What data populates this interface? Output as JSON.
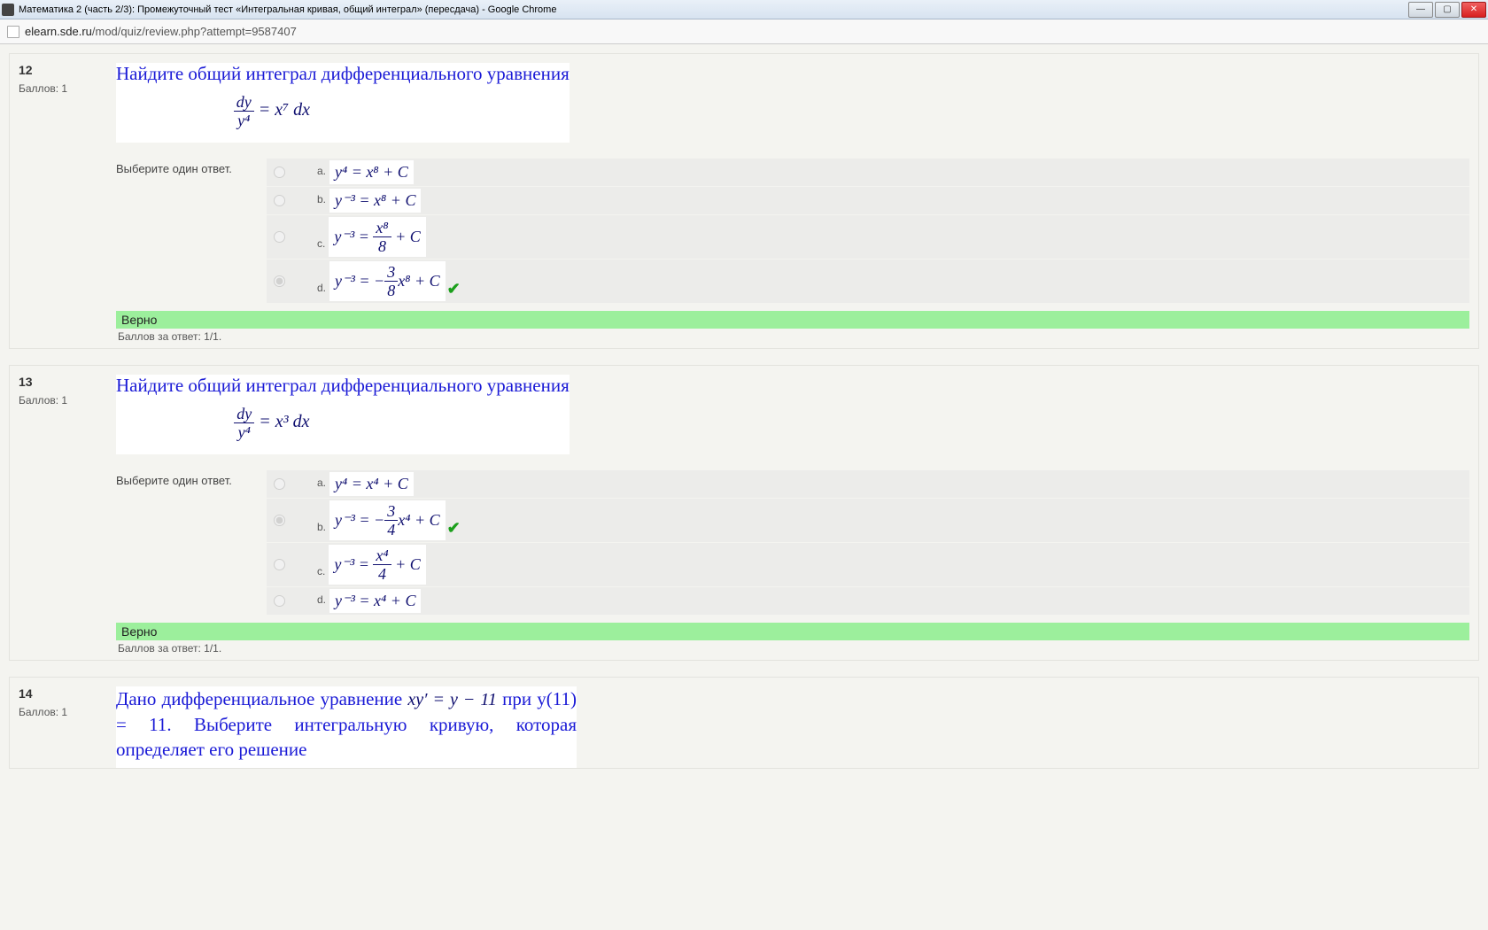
{
  "window": {
    "title": "Математика 2 (часть 2/3): Промежуточный тест «Интегральная кривая, общий интеграл» (пересдача) - Google Chrome",
    "url_domain": "elearn.sde.ru",
    "url_path": "/mod/quiz/review.php?attempt=9587407"
  },
  "common": {
    "choose_one": "Выберите один ответ.",
    "points_label": "Баллов: 1",
    "verdict_correct": "Верно",
    "score_line": "Баллов за ответ: 1/1."
  },
  "q12": {
    "num": "12",
    "prompt": "Найдите общий интеграл дифференциального уравнения",
    "equation_lhs_num": "dy",
    "equation_lhs_den": "y⁴",
    "equation_rhs": "= x⁷ dx",
    "answers": {
      "a": {
        "letter": "a.",
        "text": "y⁴ = x⁸ + C"
      },
      "b": {
        "letter": "b.",
        "text": "y⁻³ = x⁸ + C"
      },
      "c": {
        "letter": "c.",
        "lhs": "y⁻³ =",
        "frac_num": "x⁸",
        "frac_den": "8",
        "tail": "+ C"
      },
      "d": {
        "letter": "d.",
        "lhs": "y⁻³ = −",
        "frac_num": "3",
        "frac_den": "8",
        "mid": "x⁸ + C"
      }
    },
    "selected": "d",
    "correct": "d"
  },
  "q13": {
    "num": "13",
    "prompt": "Найдите общий интеграл дифференциального уравнения",
    "equation_lhs_num": "dy",
    "equation_lhs_den": "y⁴",
    "equation_rhs": "= x³ dx",
    "answers": {
      "a": {
        "letter": "a.",
        "text": "y⁴ = x⁴ + C"
      },
      "b": {
        "letter": "b.",
        "lhs": "y⁻³ = −",
        "frac_num": "3",
        "frac_den": "4",
        "mid": "x⁴ + C"
      },
      "c": {
        "letter": "c.",
        "lhs": "y⁻³ =",
        "frac_num": "x⁴",
        "frac_den": "4",
        "tail": "+ C"
      },
      "d": {
        "letter": "d.",
        "text": "y⁻³ = x⁴ + C"
      }
    },
    "selected": "b",
    "correct": "b"
  },
  "q14": {
    "num": "14",
    "prompt_part1": "Дано дифференциальное уравнение ",
    "equation_inline": "xy′ = y − 11",
    "prompt_part2": " при y(11) = 11. Выберите интегральную кривую, которая определяет его решение"
  }
}
